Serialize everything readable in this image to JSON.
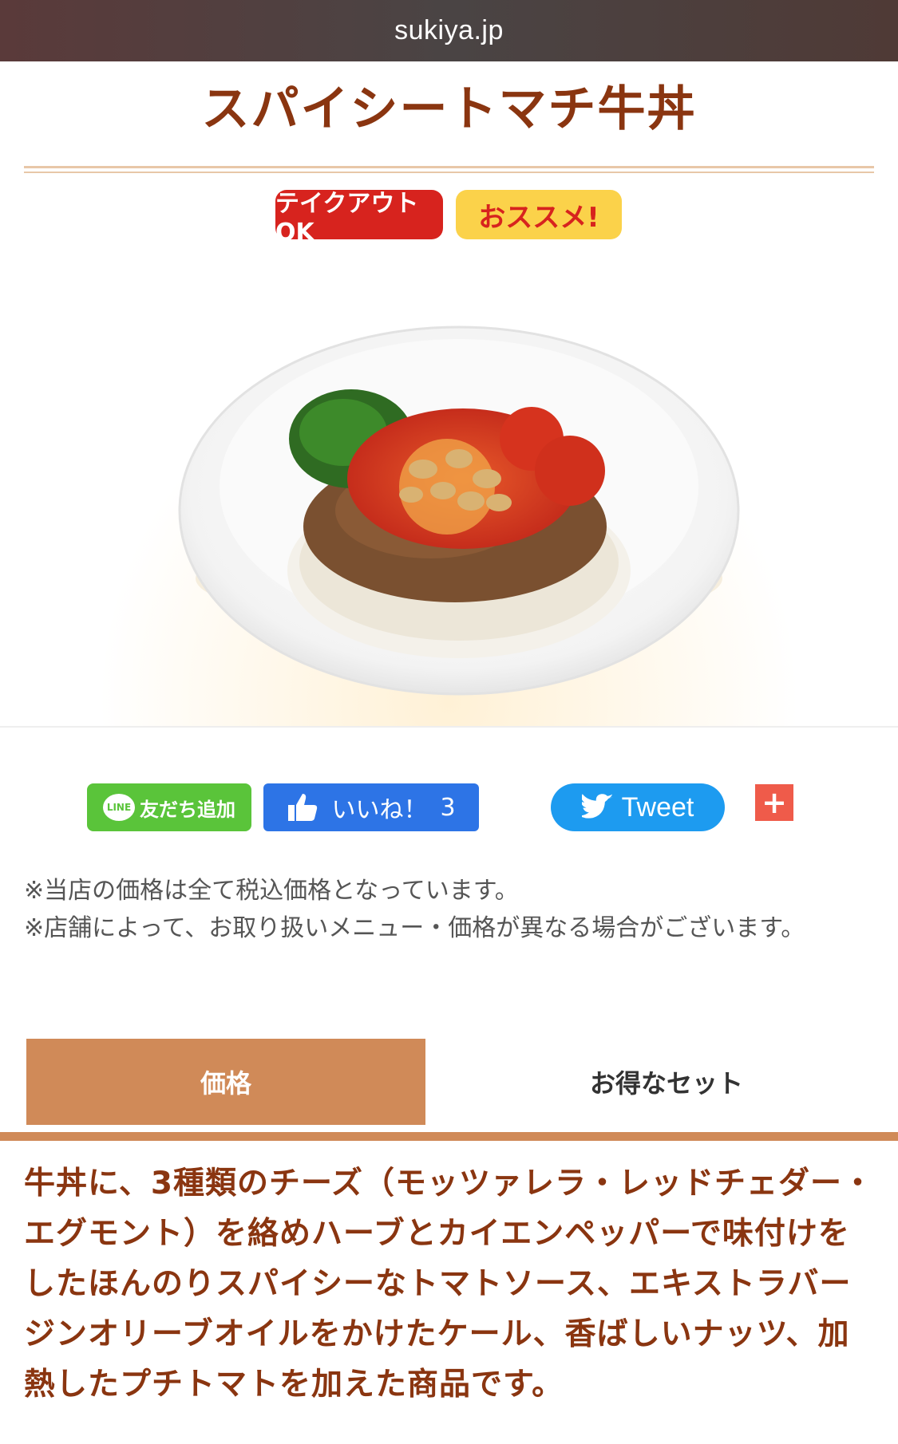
{
  "browser": {
    "url": "sukiya.jp"
  },
  "product": {
    "title": "スパイシートマチ牛丼",
    "badges": {
      "takeout": "テイクアウトOK",
      "recommend": "おススメ!"
    }
  },
  "social": {
    "line_icon": "LINE",
    "line_label": "友だち追加",
    "fb_label": "いいね！",
    "fb_count": "3",
    "tweet_label": "Tweet",
    "plus_label": "+"
  },
  "notes": {
    "line1": "※当店の価格は全て税込価格となっています。",
    "line2": "※店舗によって、お取り扱いメニュー・価格が異なる場合がございます。"
  },
  "tabs": {
    "price": "価格",
    "set": "お得なセット"
  },
  "description": "牛丼に、3種類のチーズ（モッツァレラ・レッドチェダー・エグモント）を絡めハーブとカイエンペッパーで味付けをしたほんのりスパイシーなトマトソース、エキストラバージンオリーブオイルをかけたケール、香ばしいナッツ、加熱したプチトマトを加えた商品です。",
  "colors": {
    "title": "#8a3510",
    "tab_accent": "#d08a58",
    "takeout_badge": "#d7231e",
    "recommend_badge": "#fbd24a",
    "line_green": "#5ac43a",
    "fb_blue": "#2d74e6",
    "twitter_blue": "#1d9bf0"
  }
}
